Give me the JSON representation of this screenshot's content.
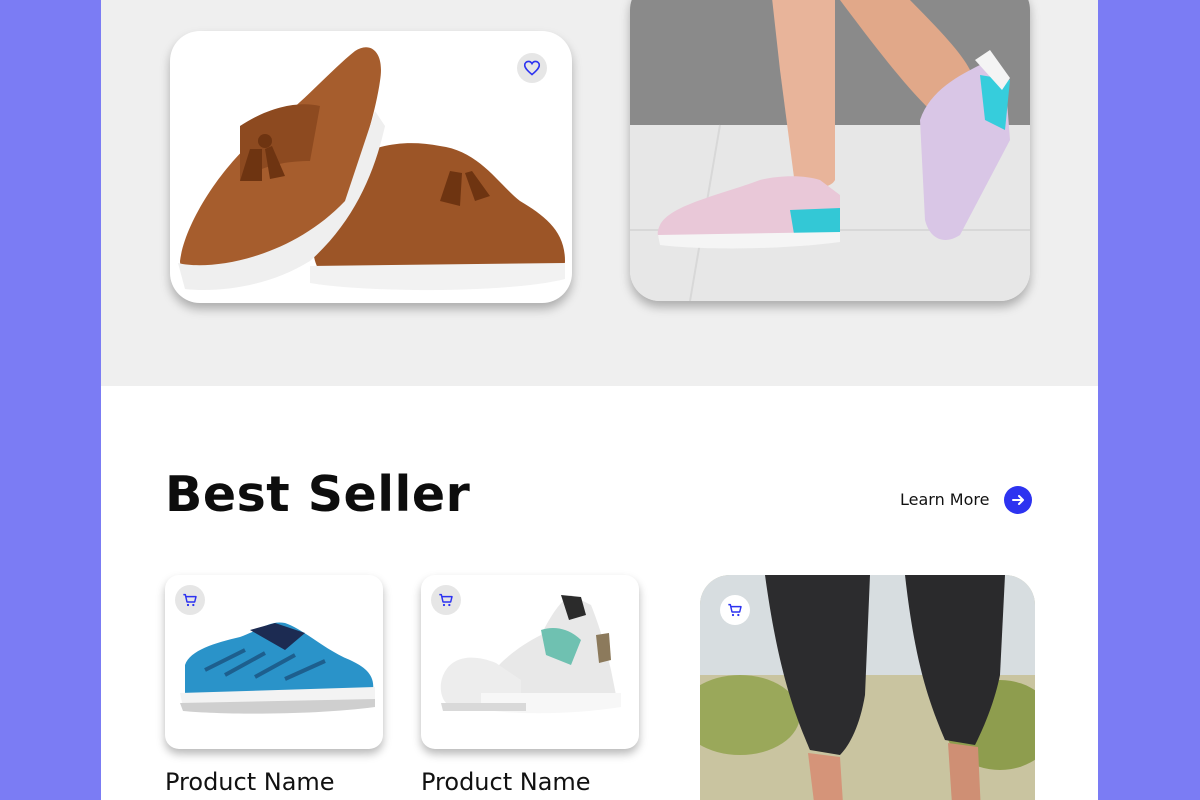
{
  "section": {
    "title": "Best Seller",
    "learn_more_label": "Learn More"
  },
  "products": [
    {
      "name": "Product Name"
    },
    {
      "name": "Product Name"
    }
  ],
  "icons": {
    "favorite": "heart-icon",
    "cart": "cart-icon",
    "arrow": "arrow-right-icon"
  },
  "colors": {
    "background": "#7b7cf4",
    "accent": "#2d33f0",
    "hero_bg": "#efefef"
  }
}
